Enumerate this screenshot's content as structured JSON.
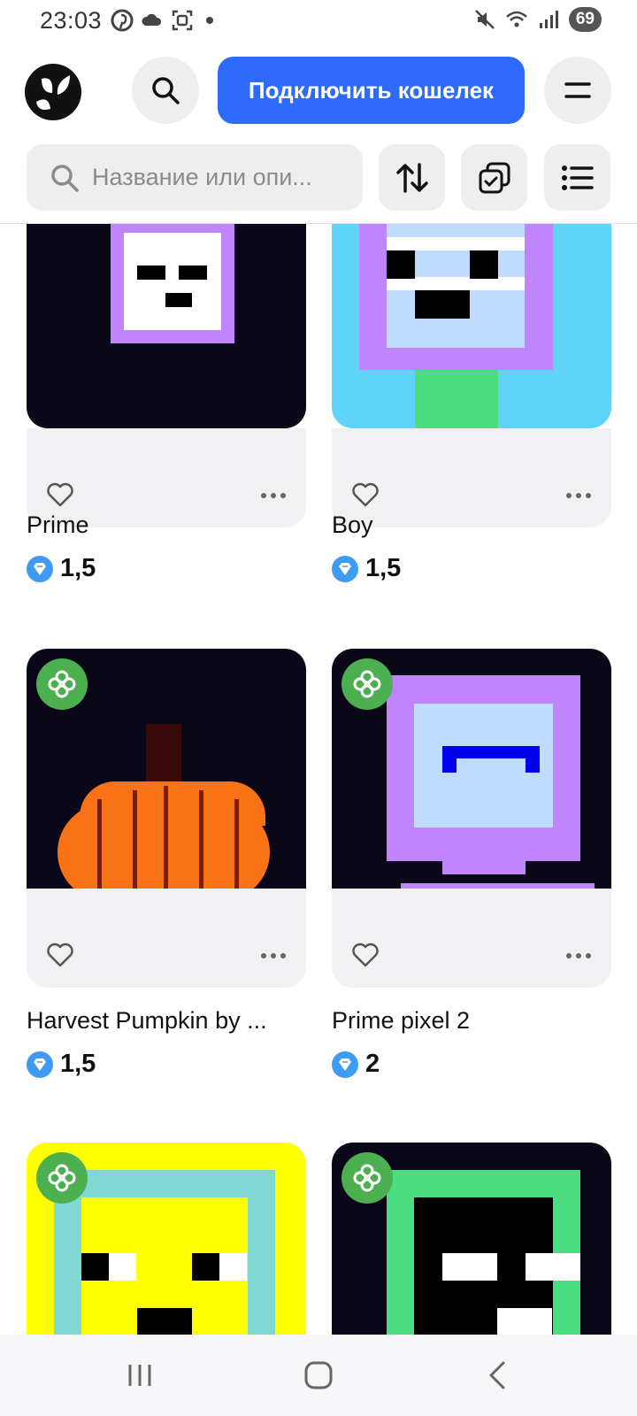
{
  "status_bar": {
    "time": "23:03",
    "battery": "69",
    "left_icons": [
      "pinterest-icon",
      "cloud-icon",
      "screenshot-icon"
    ],
    "right_icons": [
      "mute-icon",
      "wifi-icon",
      "signal-icon"
    ]
  },
  "header": {
    "logo": "getgems-logo",
    "connect_label": "Подключить кошелек"
  },
  "filters": {
    "search_placeholder": "Название или опи..."
  },
  "colors": {
    "accent": "#2e6bfa",
    "badge": "#4caf50",
    "price_icon": "#3d9cf0"
  },
  "grid": {
    "items": [
      {
        "name": "Prime",
        "price": "1,5"
      },
      {
        "name": "Boy",
        "price": "1,5"
      },
      {
        "name": "Harvest Pumpkin by ...",
        "price": "1,5"
      },
      {
        "name": "Prime pixel 2",
        "price": "2"
      },
      {
        "name": "",
        "price": ""
      },
      {
        "name": "",
        "price": ""
      }
    ]
  }
}
